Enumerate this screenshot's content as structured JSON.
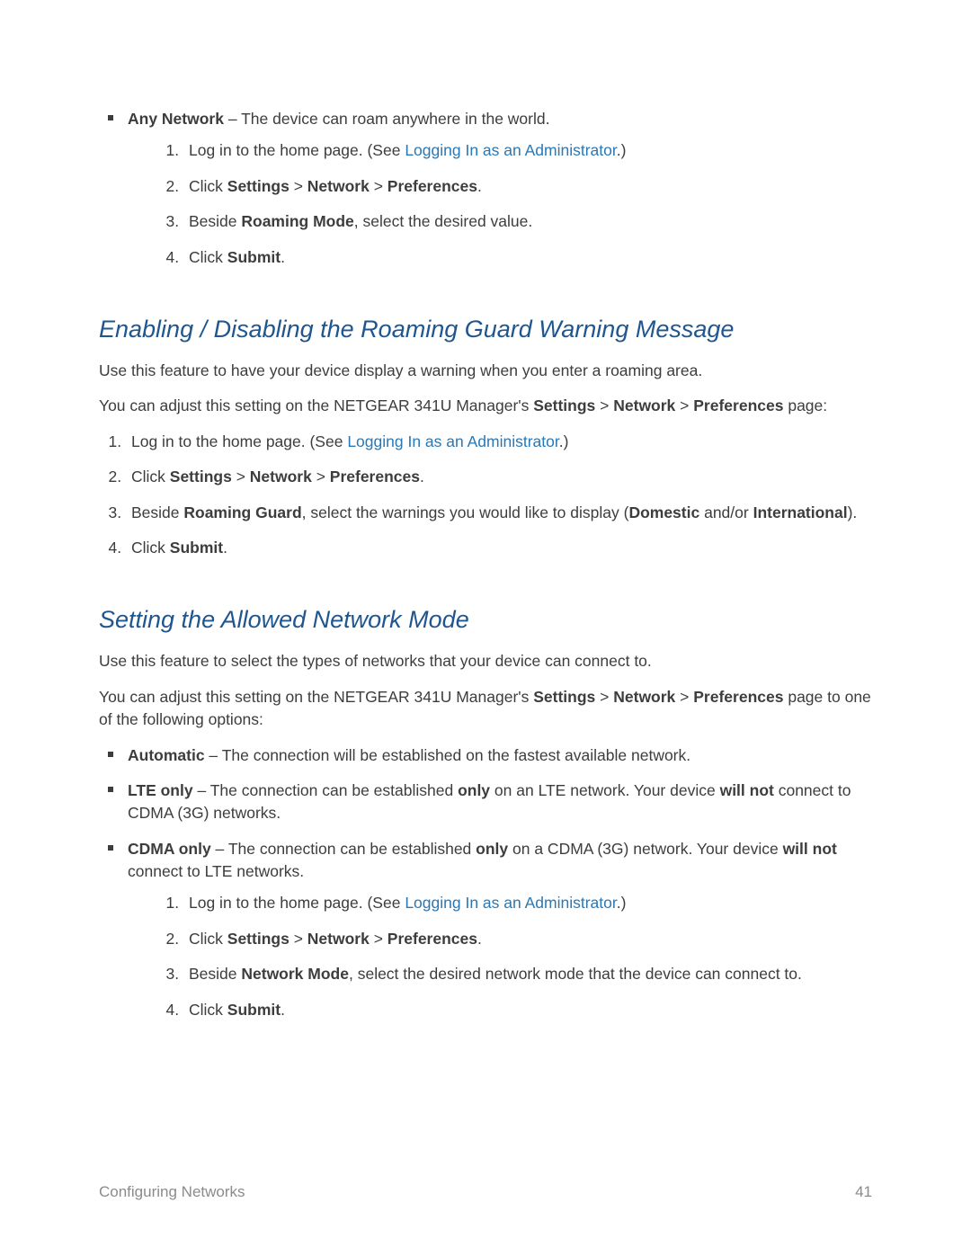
{
  "anyNetwork": {
    "label": "Any Network",
    "desc": " – The device can roam anywhere in the world.",
    "steps": {
      "s1a": "Log in to the home page. (See ",
      "s1link": "Logging In as an Administrator",
      "s1b": ".)",
      "s2a": "Click ",
      "s2b": "Settings",
      "s2sep1": "  >  ",
      "s2c": "Network",
      "s2sep2": "  >  ",
      "s2d": "Preferences",
      "s2end": ".",
      "s3a": "Beside ",
      "s3b": "Roaming Mode",
      "s3c": ", select the desired value.",
      "s4a": "Click ",
      "s4b": "Submit",
      "s4c": "."
    }
  },
  "roamGuard": {
    "heading": "Enabling / Disabling the Roaming Guard Warning Message",
    "intro": "Use this feature to have your device display a warning when you enter a roaming area.",
    "p2a": "You can adjust this setting on the NETGEAR 341U Manager's ",
    "p2b": "Settings",
    "p2sep1": " > ",
    "p2c": "Network",
    "p2sep2": " > ",
    "p2d": "Preferences",
    "p2e": " page:",
    "steps": {
      "s1a": "Log in to the home page. (See ",
      "s1link": "Logging In as an Administrator",
      "s1b": ".)",
      "s2a": "Click ",
      "s2b": "Settings",
      "s2sep1": " > ",
      "s2c": "Network",
      "s2sep2": " > ",
      "s2d": "Preferences",
      "s2end": ".",
      "s3a": "Beside ",
      "s3b": "Roaming Guard",
      "s3c": ", select the warnings you would like to display (",
      "s3d": "Domestic",
      "s3e": " and/or ",
      "s3f": "International",
      "s3g": ").",
      "s4a": "Click ",
      "s4b": "Submit",
      "s4c": "."
    }
  },
  "netMode": {
    "heading": "Setting the Allowed Network Mode",
    "intro": "Use this feature to select the types of networks that your device can connect to.",
    "p2a": "You can adjust this setting on the NETGEAR 341U Manager's ",
    "p2b": "Settings",
    "p2sep1": " > ",
    "p2c": "Network",
    "p2sep2": " > ",
    "p2d": "Preferences",
    "p2e": " page to one of the following options:",
    "auto": {
      "label": "Automatic",
      "desc": " – The connection will be established on the fastest available network."
    },
    "lte": {
      "label": "LTE  only",
      "a": " – The connection can be established ",
      "b": "only",
      "c": " on an LTE network. Your device ",
      "d": "will  not",
      "e": " connect to CDMA (3G) networks."
    },
    "cdma": {
      "label": "CDMA  only",
      "a": " – The connection can be established ",
      "b": "only",
      "c": " on a CDMA (3G) network. Your device ",
      "d": "will not",
      "e": " connect to LTE networks."
    },
    "steps": {
      "s1a": "Log in to the home page. (See ",
      "s1link": "Logging In as an Administrator",
      "s1b": ".)",
      "s2a": "Click ",
      "s2b": "Settings",
      "s2sep1": "  >  ",
      "s2c": "Network",
      "s2sep2": "  >  ",
      "s2d": "Preferences",
      "s2end": ".",
      "s3a": "Beside ",
      "s3b": "Network Mode",
      "s3c": ", select the desired network mode that the device can connect to.",
      "s4a": "Click ",
      "s4b": "Submit",
      "s4c": "."
    }
  },
  "footer": {
    "section": "Configuring Networks",
    "page": "41"
  }
}
